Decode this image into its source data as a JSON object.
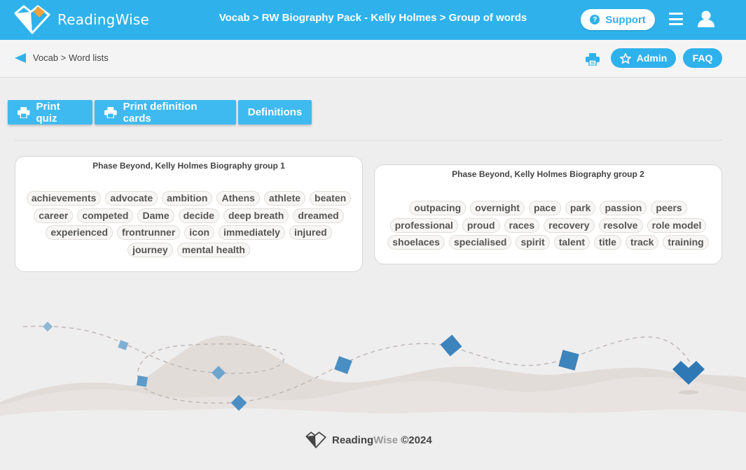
{
  "app": {
    "name": "ReadingWise",
    "name_part1": "Reading",
    "name_part2": "Wise"
  },
  "header": {
    "breadcrumb_title": "Vocab > RW Biography Pack - Kelly Holmes > Group of words",
    "support_label": "Support",
    "icons": [
      "question-circle-icon",
      "hamburger-menu-icon",
      "user-icon"
    ]
  },
  "subbar": {
    "breadcrumb": "Vocab > Word lists",
    "admin_label": "Admin",
    "faq_label": "FAQ",
    "icons": [
      "back-arrow-icon",
      "printer-icon",
      "star-icon"
    ]
  },
  "actions": {
    "print_quiz": "Print quiz",
    "print_cards": "Print definition cards",
    "definitions": "Definitions"
  },
  "groups": [
    {
      "title": "Phase Beyond, Kelly Holmes Biography group 1",
      "words": [
        "achievements",
        "advocate",
        "ambition",
        "Athens",
        "athlete",
        "beaten",
        "career",
        "competed",
        "Dame",
        "decide",
        "deep breath",
        "dreamed",
        "experienced",
        "frontrunner",
        "icon",
        "immediately",
        "injured",
        "journey",
        "mental health"
      ]
    },
    {
      "title": "Phase Beyond, Kelly Holmes Biography group 2",
      "words": [
        "outpacing",
        "overnight",
        "pace",
        "park",
        "passion",
        "peers",
        "professional",
        "proud",
        "races",
        "recovery",
        "resolve",
        "role model",
        "shoelaces",
        "specialised",
        "spirit",
        "talent",
        "title",
        "track",
        "training"
      ]
    }
  ],
  "footer": {
    "copyright": "©2024"
  },
  "colors": {
    "brand": "#2fb2ec",
    "button": "#3fbaf0",
    "decoration": "#4a8fc4"
  }
}
